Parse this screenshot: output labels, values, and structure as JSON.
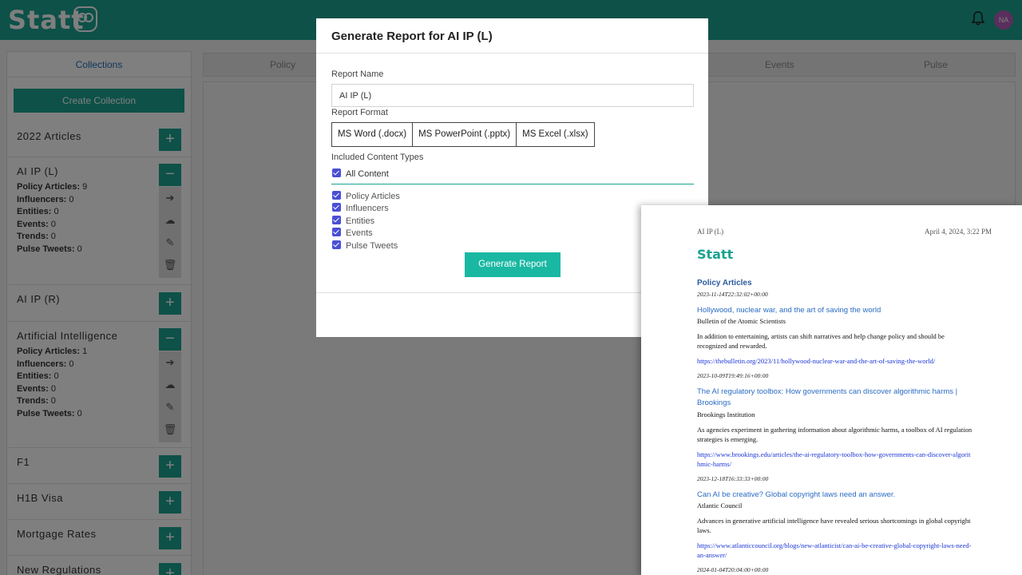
{
  "app": {
    "logo": "Statt",
    "avatar_initials": "NA",
    "sidebar_tab": "Collections",
    "create_collection_label": "Create Collection",
    "tabs": [
      "Policy",
      "Events",
      "Pulse"
    ],
    "accent_color": "#1aa391"
  },
  "collections": [
    {
      "name": "2022 Articles",
      "expanded": false
    },
    {
      "name": "AI IP (L)",
      "expanded": true,
      "stats": [
        {
          "label": "Policy Articles:",
          "value": "9"
        },
        {
          "label": "Influencers:",
          "value": "0"
        },
        {
          "label": "Entities:",
          "value": "0"
        },
        {
          "label": "Events:",
          "value": "0"
        },
        {
          "label": "Trends:",
          "value": "0"
        },
        {
          "label": "Pulse Tweets:",
          "value": "0"
        }
      ]
    },
    {
      "name": "AI IP (R)",
      "expanded": false
    },
    {
      "name": "Artificial Intelligence",
      "expanded": true,
      "stats": [
        {
          "label": "Policy Articles:",
          "value": "1"
        },
        {
          "label": "Influencers:",
          "value": "0"
        },
        {
          "label": "Entities:",
          "value": "0"
        },
        {
          "label": "Events:",
          "value": "0"
        },
        {
          "label": "Trends:",
          "value": "0"
        },
        {
          "label": "Pulse Tweets:",
          "value": "0"
        }
      ]
    },
    {
      "name": "F1",
      "expanded": false
    },
    {
      "name": "H1B Visa",
      "expanded": false
    },
    {
      "name": "Mortgage Rates",
      "expanded": false
    },
    {
      "name": "New Regulations",
      "expanded": false
    }
  ],
  "modal": {
    "title": "Generate Report for AI IP (L)",
    "report_name_label": "Report Name",
    "report_name_value": "AI IP (L)",
    "report_format_label": "Report Format",
    "formats": [
      "MS Word (.docx)",
      "MS PowerPoint (.pptx)",
      "MS Excel (.xlsx)"
    ],
    "content_types_label": "Included Content Types",
    "all_content_label": "All Content",
    "content_types": [
      "Policy Articles",
      "Influencers",
      "Entities",
      "Events",
      "Pulse Tweets"
    ],
    "generate_label": "Generate Report"
  },
  "preview": {
    "header_left": "AI IP (L)",
    "header_right": "April 4, 2024, 3:22 PM",
    "logo": "Statt",
    "section": "Policy Articles",
    "articles": [
      {
        "date": "2023-11-14T22:32:02+00:00",
        "title": "Hollywood, nuclear war, and the art of saving the world",
        "source": "Bulletin of the Atomic Scientists",
        "summary": "In addition to entertaining, artists can shift narratives and help change policy and should be recognized and rewarded.",
        "url": "https://thebulletin.org/2023/11/hollywood-nuclear-war-and-the-art-of-saving-the-world/"
      },
      {
        "date": "2023-10-09T19:49:16+00:00",
        "title": "The AI regulatory toolbox: How governments can discover algorithmic harms | Brookings",
        "source": "Brookings Institution",
        "summary": "As agencies experiment in gathering information about algorithmic harms, a toolbox of AI regulation strategies is emerging.",
        "url": "https://www.brookings.edu/articles/the-ai-regulatory-toolbox-how-governments-can-discover-algorithmic-harms/"
      },
      {
        "date": "2023-12-18T16:33:33+00:00",
        "title": "Can AI be creative? Global copyright laws need an answer.",
        "source": "Atlantic Council",
        "summary": "Advances in generative artificial intelligence have revealed serious shortcomings in global copyright laws.",
        "url": "https://www.atlanticcouncil.org/blogs/new-atlanticist/can-ai-be-creative-global-copyright-laws-need-an-answer/"
      },
      {
        "date": "2024-01-04T20:04:00+00:00"
      }
    ]
  }
}
